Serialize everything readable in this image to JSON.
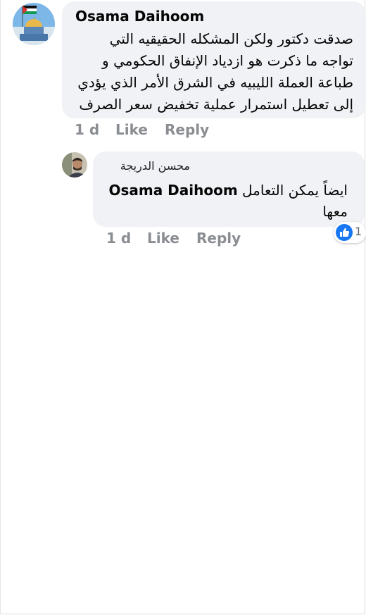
{
  "comment": {
    "author": "Osama Daihoom",
    "lines": [
      "صدقت دكتور ولكن المشكله الحقيقيه التي",
      "تواجه ما ذكرت هو ازدياد الإنفاق الحكومي و",
      "طباعة العملة الليبيه في الشرق الأمر الذي يؤدي",
      "إلى تعطيل استمرار عملية تخفيض سعر الصرف"
    ],
    "time": "1 d",
    "like_label": "Like",
    "reply_label": "Reply",
    "avatar_icon": "palestine-flag-dome-avatar"
  },
  "reply": {
    "author": "محسن الدريجة",
    "mention": "Osama Daihoom",
    "text_after_mention": "ايضاً يمكن التعامل",
    "second_line": "معها",
    "time": "1 d",
    "like_label": "Like",
    "reply_label": "Reply",
    "reaction_count": "1",
    "reaction_icon": "like-reaction-icon",
    "avatar_icon": "man-photo-avatar"
  },
  "colors": {
    "bubble": "#f0f2f5",
    "action_text": "#8a8d91",
    "like_blue": "#1877f2"
  }
}
